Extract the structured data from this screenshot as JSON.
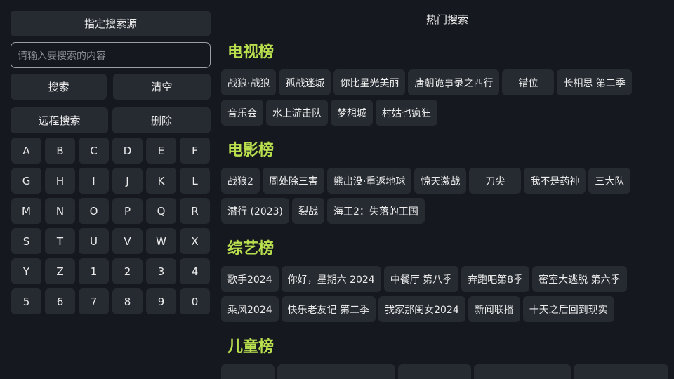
{
  "left": {
    "source_button": "指定搜索源",
    "search_placeholder": "请输入要搜索的内容",
    "search_button": "搜索",
    "clear_button": "清空",
    "remote_button": "远程搜索",
    "delete_button": "删除",
    "keys": [
      "A",
      "B",
      "C",
      "D",
      "E",
      "F",
      "G",
      "H",
      "I",
      "J",
      "K",
      "L",
      "M",
      "N",
      "O",
      "P",
      "Q",
      "R",
      "S",
      "T",
      "U",
      "V",
      "W",
      "X",
      "Y",
      "Z",
      "1",
      "2",
      "3",
      "4",
      "5",
      "6",
      "7",
      "8",
      "9",
      "0"
    ]
  },
  "right": {
    "title": "热门搜索",
    "sections": [
      {
        "title": "电视榜",
        "items": [
          "战狼·战狼",
          "孤战迷城",
          "你比星光美丽",
          "唐朝诡事录之西行",
          "错位",
          "长相思 第二季",
          "音乐会",
          "水上游击队",
          "梦想城",
          "村姑也疯狂"
        ]
      },
      {
        "title": "电影榜",
        "items": [
          "战狼2",
          "周处除三害",
          "熊出没·重返地球",
          "惊天激战",
          "刀尖",
          "我不是药神",
          "三大队",
          "潜行 (2023)",
          "裂战",
          "海王2：失落的王国"
        ]
      },
      {
        "title": "综艺榜",
        "items": [
          "歌手2024",
          "你好，星期六 2024",
          "中餐厅 第八季",
          "奔跑吧第8季",
          "密室大逃脱 第六季",
          "乘风2024",
          "快乐老友记 第二季",
          "我家那闺女2024",
          "新闻联播",
          "十天之后回到现实"
        ]
      },
      {
        "title": "儿童榜",
        "items": []
      }
    ]
  }
}
